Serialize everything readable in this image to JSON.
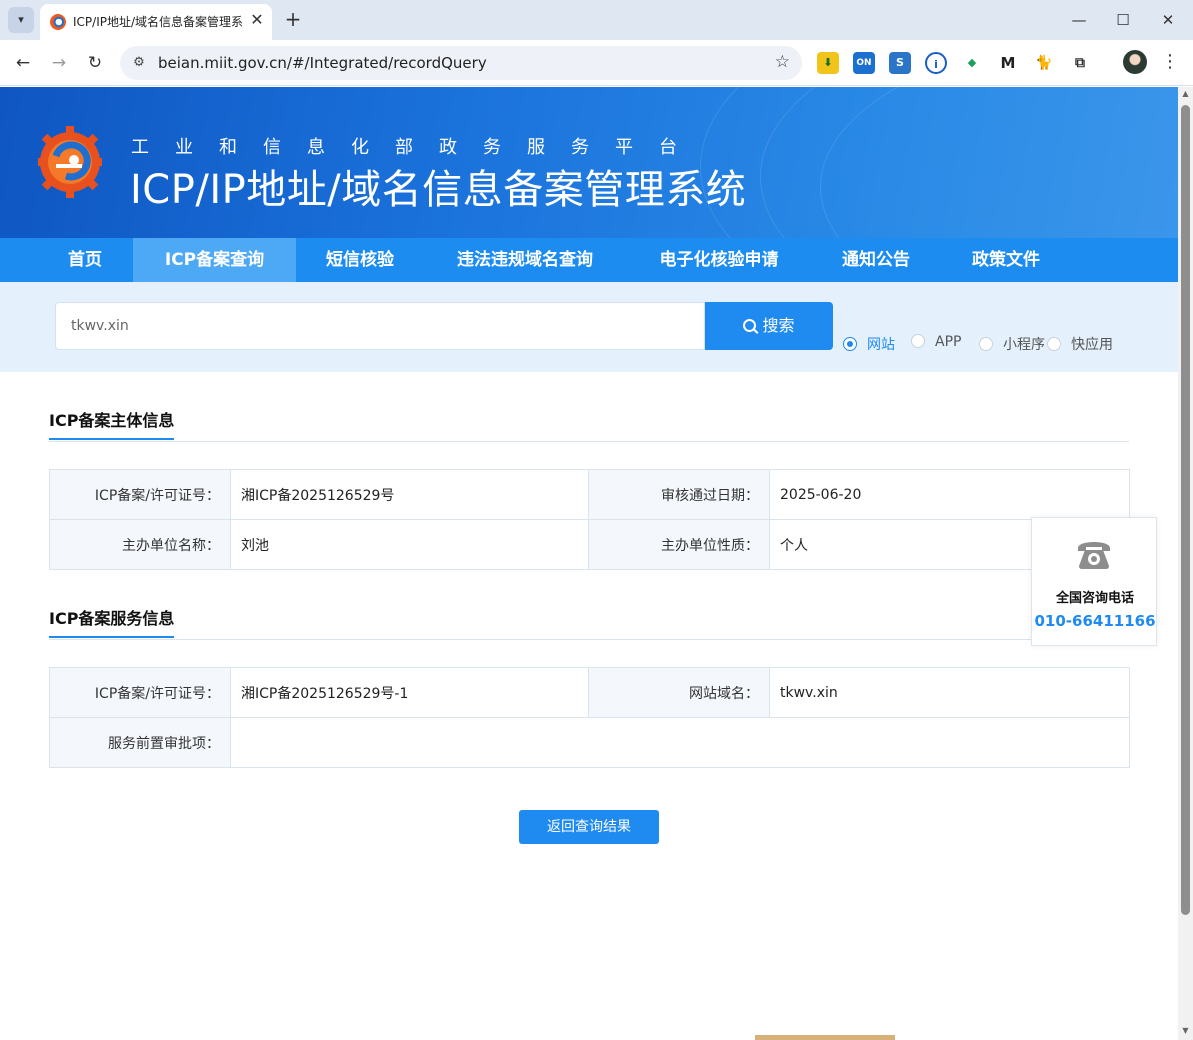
{
  "browser": {
    "tab_title": "ICP/IP地址/域名信息备案管理系",
    "url": "beian.miit.gov.cn/#/Integrated/recordQuery",
    "extensions": [
      "download-extension-icon",
      "on-extension-icon",
      "s-extension-icon",
      "info-extension-icon",
      "bird-extension-icon",
      "m-extension-icon",
      "cat-extension-icon",
      "puzzle-extensions-icon"
    ]
  },
  "header": {
    "subtitle": "工业和信息化部政务服务平台",
    "title": "ICP/IP地址/域名信息备案管理系统"
  },
  "nav": {
    "items": [
      "首页",
      "ICP备案查询",
      "短信核验",
      "违法违规域名查询",
      "电子化核验申请",
      "通知公告",
      "政策文件"
    ],
    "active_index": 1
  },
  "search": {
    "value": "tkwv.xin",
    "button_label": "搜索",
    "options": [
      "网站",
      "APP",
      "小程序",
      "快应用"
    ],
    "selected_option": "网站"
  },
  "subject_info": {
    "title": "ICP备案主体信息",
    "rows": [
      {
        "label1": "ICP备案/许可证号：",
        "value1": "湘ICP备2025126529号",
        "label2": "审核通过日期：",
        "value2": "2025-06-20"
      },
      {
        "label1": "主办单位名称：",
        "value1": "刘池",
        "label2": "主办单位性质：",
        "value2": "个人"
      }
    ]
  },
  "service_info": {
    "title": "ICP备案服务信息",
    "row1": {
      "label1": "ICP备案/许可证号：",
      "value1": "湘ICP备2025126529号-1",
      "label2": "网站域名：",
      "value2": "tkwv.xin"
    },
    "row2": {
      "label": "服务前置审批项：",
      "value": ""
    }
  },
  "return_button": "返回查询结果",
  "hotline": {
    "label": "全国咨询电话",
    "number": "010-66411166"
  },
  "colors": {
    "primary": "#1f8af0",
    "nav_bg": "#1c8cf0",
    "nav_active": "#4da8f5",
    "search_band": "#e4f1fd"
  }
}
